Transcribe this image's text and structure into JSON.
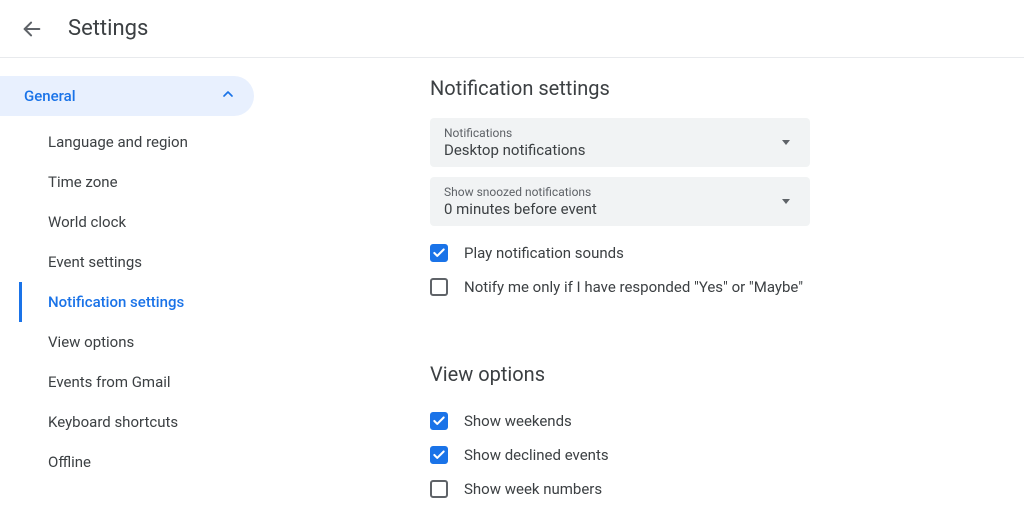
{
  "header": {
    "title": "Settings"
  },
  "sidebar": {
    "group_label": "General",
    "items": [
      {
        "label": "Language and region"
      },
      {
        "label": "Time zone"
      },
      {
        "label": "World clock"
      },
      {
        "label": "Event settings"
      },
      {
        "label": "Notification settings"
      },
      {
        "label": "View options"
      },
      {
        "label": "Events from Gmail"
      },
      {
        "label": "Keyboard shortcuts"
      },
      {
        "label": "Offline"
      }
    ],
    "active_index": 4
  },
  "main": {
    "notification_section": {
      "title": "Notification settings",
      "notifications_dropdown": {
        "label": "Notifications",
        "value": "Desktop notifications"
      },
      "snoozed_dropdown": {
        "label": "Show snoozed notifications",
        "value": "0 minutes before event"
      },
      "play_sounds": {
        "label": "Play notification sounds",
        "checked": true
      },
      "notify_only_responded": {
        "label": "Notify me only if I have responded \"Yes\" or \"Maybe\"",
        "checked": false
      }
    },
    "view_section": {
      "title": "View options",
      "show_weekends": {
        "label": "Show weekends",
        "checked": true
      },
      "show_declined": {
        "label": "Show declined events",
        "checked": true
      },
      "show_week_numbers": {
        "label": "Show week numbers",
        "checked": false
      }
    }
  }
}
